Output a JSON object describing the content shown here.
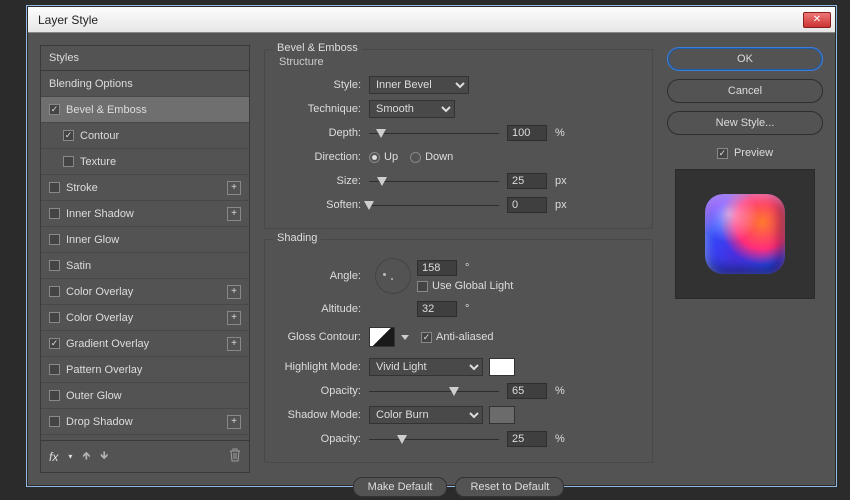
{
  "dialog": {
    "title": "Layer Style"
  },
  "sidebar": {
    "header": "Styles",
    "items": [
      {
        "label": "Blending Options",
        "checked": null,
        "indent": false,
        "plus": false,
        "selected": false
      },
      {
        "label": "Bevel & Emboss",
        "checked": true,
        "indent": false,
        "plus": false,
        "selected": true
      },
      {
        "label": "Contour",
        "checked": true,
        "indent": true,
        "plus": false,
        "selected": false
      },
      {
        "label": "Texture",
        "checked": false,
        "indent": true,
        "plus": false,
        "selected": false
      },
      {
        "label": "Stroke",
        "checked": false,
        "indent": false,
        "plus": true,
        "selected": false
      },
      {
        "label": "Inner Shadow",
        "checked": false,
        "indent": false,
        "plus": true,
        "selected": false
      },
      {
        "label": "Inner Glow",
        "checked": false,
        "indent": false,
        "plus": false,
        "selected": false
      },
      {
        "label": "Satin",
        "checked": false,
        "indent": false,
        "plus": false,
        "selected": false
      },
      {
        "label": "Color Overlay",
        "checked": false,
        "indent": false,
        "plus": true,
        "selected": false
      },
      {
        "label": "Color Overlay",
        "checked": false,
        "indent": false,
        "plus": true,
        "selected": false
      },
      {
        "label": "Gradient Overlay",
        "checked": true,
        "indent": false,
        "plus": true,
        "selected": false
      },
      {
        "label": "Pattern Overlay",
        "checked": false,
        "indent": false,
        "plus": false,
        "selected": false
      },
      {
        "label": "Outer Glow",
        "checked": false,
        "indent": false,
        "plus": false,
        "selected": false
      },
      {
        "label": "Drop Shadow",
        "checked": false,
        "indent": false,
        "plus": true,
        "selected": false
      }
    ],
    "fx_label": "fx"
  },
  "structure": {
    "group_title": "Bevel & Emboss",
    "group_sub": "Structure",
    "style_label": "Style:",
    "style_value": "Inner Bevel",
    "technique_label": "Technique:",
    "technique_value": "Smooth",
    "depth_label": "Depth:",
    "depth_value": "100",
    "depth_unit": "%",
    "direction_label": "Direction:",
    "direction_up": "Up",
    "direction_down": "Down",
    "size_label": "Size:",
    "size_value": "25",
    "size_unit": "px",
    "soften_label": "Soften:",
    "soften_value": "0",
    "soften_unit": "px"
  },
  "shading": {
    "group_title": "Shading",
    "angle_label": "Angle:",
    "angle_value": "158",
    "angle_unit": "°",
    "global_light": "Use Global Light",
    "altitude_label": "Altitude:",
    "altitude_value": "32",
    "altitude_unit": "°",
    "gloss_label": "Gloss Contour:",
    "antialias": "Anti-aliased",
    "highlight_mode_label": "Highlight Mode:",
    "highlight_mode_value": "Vivid Light",
    "highlight_opacity_label": "Opacity:",
    "highlight_opacity_value": "65",
    "highlight_opacity_unit": "%",
    "shadow_mode_label": "Shadow Mode:",
    "shadow_mode_value": "Color Burn",
    "shadow_opacity_label": "Opacity:",
    "shadow_opacity_value": "25",
    "shadow_opacity_unit": "%"
  },
  "buttons": {
    "make_default": "Make Default",
    "reset_default": "Reset to Default",
    "ok": "OK",
    "cancel": "Cancel",
    "new_style": "New Style...",
    "preview": "Preview"
  }
}
